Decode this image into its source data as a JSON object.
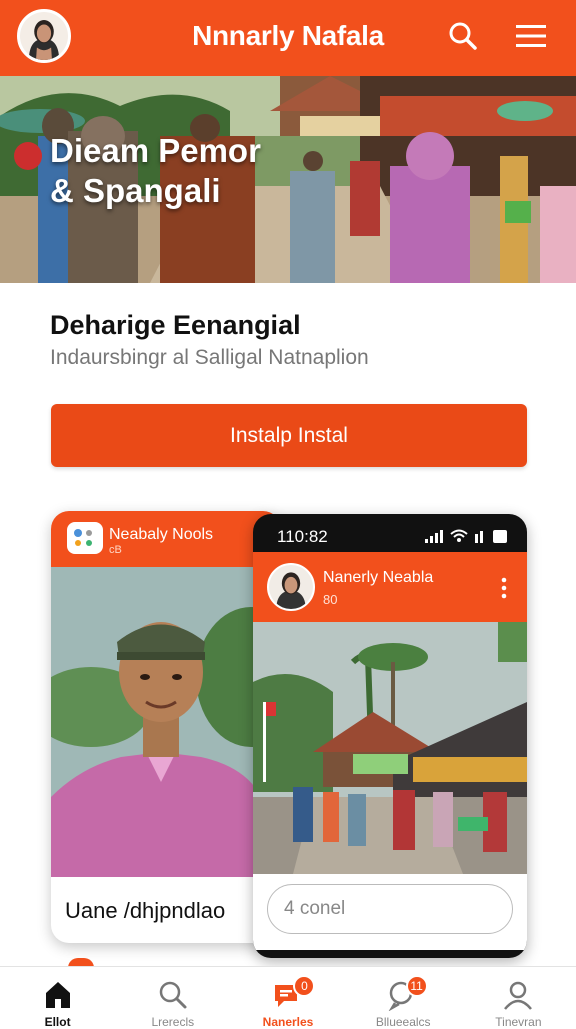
{
  "header": {
    "title": "Nnnarly Nafala",
    "icons": [
      "avatar",
      "search-icon",
      "menu-icon"
    ]
  },
  "hero": {
    "title_line1": "Dieam Pemor",
    "title_line2": "& Spangali"
  },
  "section": {
    "title": "Deharige Eenangial",
    "subtitle": "Indaursbingr al Salligal Natnaplion"
  },
  "install_button": {
    "label": "Instalp Instal"
  },
  "card_left": {
    "app_name": "Neabaly Nools",
    "meta": "cB",
    "caption": "Uane /dhjpndlao"
  },
  "phone": {
    "time": "110:82",
    "profile_name": "Nanerly Neabla",
    "profile_meta": "80",
    "input_placeholder": "4 conel"
  },
  "bottom_nav": {
    "items": [
      {
        "label": "Ellot",
        "icon": "home-icon"
      },
      {
        "label": "Lrerecls",
        "icon": "search-icon"
      },
      {
        "label": "Nanerles",
        "icon": "chat-icon",
        "badge": "0"
      },
      {
        "label": "Bllueealcs",
        "icon": "search-chat-icon",
        "badge": "11"
      },
      {
        "label": "Tinevran",
        "icon": "profile-icon"
      }
    ]
  },
  "colors": {
    "brand": "#f2501c",
    "text": "#111111",
    "muted": "#777777"
  }
}
